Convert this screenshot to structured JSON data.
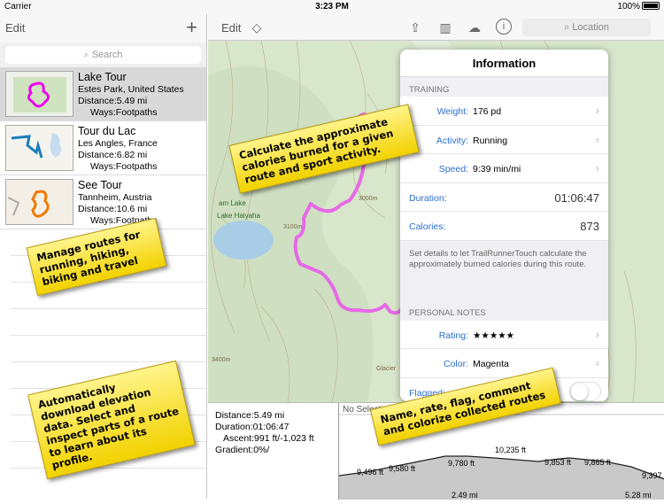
{
  "status": {
    "carrier": "Carrier",
    "time": "3:23 PM",
    "battery": "100%"
  },
  "left": {
    "edit_label": "Edit",
    "add_label": "+",
    "search_placeholder": "Search",
    "routes": [
      {
        "title": "Lake Tour",
        "place": "Estes Park, United States",
        "distance": "Distance:5.49 mi",
        "ways": "Ways:Footpaths"
      },
      {
        "title": "Tour du Lac",
        "place": "Les Angles, France",
        "distance": "Distance:6.82 mi",
        "ways": "Ways:Footpaths"
      },
      {
        "title": "See Tour",
        "place": "Tannheim, Austria",
        "distance": "Distance:10.6 mi",
        "ways": "Ways:Footpaths"
      }
    ]
  },
  "right_nav": {
    "edit_label": "Edit",
    "location_placeholder": "Location"
  },
  "map_labels": {
    "lake": "am Lake",
    "lake2": "Lake Haiyaha",
    "c1": "3100m",
    "c2": "3400m",
    "c3": "3000m",
    "glacier": "Glacier"
  },
  "info": {
    "title": "Information",
    "training_header": "TRAINING",
    "weight_label": "Weight:",
    "weight_value": "176 pd",
    "activity_label": "Activity:",
    "activity_value": "Running",
    "speed_label": "Speed:",
    "speed_value": "9:39 min/mi",
    "duration_label": "Duration:",
    "duration_value": "01:06:47",
    "calories_label": "Calories:",
    "calories_value": "873",
    "note": "Set details to let TrailRunnerTouch calculate the approximately burned calories during this route.",
    "notes_header": "PERSONAL NOTES",
    "rating_label": "Rating:",
    "rating_value": "★★★★★",
    "color_label": "Color:",
    "color_value": "Magenta",
    "flagged_label": "Flagged:"
  },
  "stats": {
    "distance": "Distance:5.49 mi",
    "duration": "Duration:01:06:47",
    "ascent": "Ascent:991 ft/-1,023 ft",
    "gradient": "Gradient:0%/"
  },
  "profile": {
    "no_selection": "No Selection",
    "labels": [
      "10,235 ft",
      "9,496 ft",
      "9,580 ft",
      "9,780 ft",
      "9,853 ft",
      "9,865 ft",
      "9,397",
      "2.49 mi",
      "5.28 mi"
    ]
  },
  "callouts": {
    "calories": "Calculate the approximate calories burned for a given route and sport activity.",
    "manage": "Manage routes for running, hiking, biking and travel",
    "elevation": "Automatically download elevation data. Select and inspect parts of a route to learn about its profile.",
    "notes": "Name, rate, flag, comment and colorize collected routes"
  },
  "colors": {
    "route": "#e66ae6",
    "link": "#2a6fd1",
    "callout": "#f5dc1e"
  }
}
